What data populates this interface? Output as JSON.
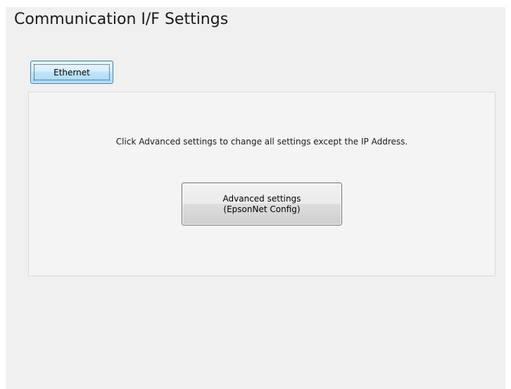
{
  "page": {
    "title": "Communication I/F Settings"
  },
  "tabs": [
    {
      "label": "Ethernet",
      "selected": true
    }
  ],
  "panel": {
    "info_text": "Click Advanced settings to change all settings except the IP Address.",
    "advanced_button": {
      "line1": "Advanced settings",
      "line2": "(EpsonNet Config)"
    }
  },
  "colors": {
    "window_bg": "#f0f0f0",
    "tab_border": "#3c7fb1",
    "tab_fill": "#bde6fd",
    "button_border": "#707070"
  }
}
